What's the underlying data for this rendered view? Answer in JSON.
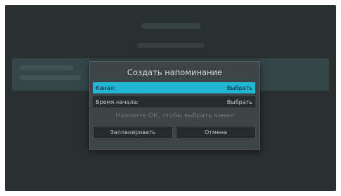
{
  "dialog": {
    "title": "Создать напоминание",
    "rows": [
      {
        "label": "Канал:",
        "value": "Выбрать",
        "selected": true
      },
      {
        "label": "Время начала:",
        "value": "Выбрать",
        "selected": false
      }
    ],
    "hint": "Нажмите ОК, чтобы выбрать канал",
    "buttons": {
      "schedule": "Запланировать",
      "cancel": "Отмена"
    }
  },
  "colors": {
    "screen_background": "#2a2f30",
    "dialog_background": "#3c4444",
    "selection_accent": "#22b6d6"
  }
}
